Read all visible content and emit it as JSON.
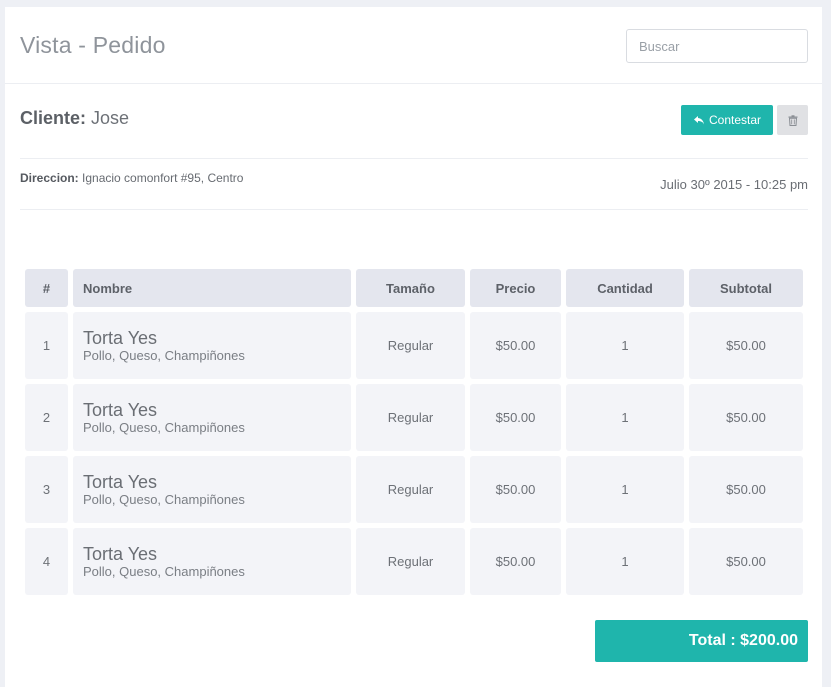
{
  "header": {
    "title": "Vista - Pedido",
    "search_placeholder": "Buscar"
  },
  "client": {
    "label": "Cliente:",
    "name": "Jose"
  },
  "actions": {
    "reply_label": "Contestar",
    "reply_icon": "reply-icon",
    "delete_icon": "trash-icon"
  },
  "address": {
    "label": "Direccion:",
    "value": "Ignacio comonfort #95, Centro"
  },
  "date": "Julio 30º 2015 - 10:25 pm",
  "table": {
    "headers": [
      "#",
      "Nombre",
      "Tamaño",
      "Precio",
      "Cantidad",
      "Subtotal"
    ],
    "rows": [
      {
        "num": "1",
        "name": "Torta Yes",
        "desc": "Pollo, Queso, Champiñones",
        "size": "Regular",
        "price": "$50.00",
        "qty": "1",
        "subtotal": "$50.00"
      },
      {
        "num": "2",
        "name": "Torta Yes",
        "desc": "Pollo, Queso, Champiñones",
        "size": "Regular",
        "price": "$50.00",
        "qty": "1",
        "subtotal": "$50.00"
      },
      {
        "num": "3",
        "name": "Torta Yes",
        "desc": "Pollo, Queso, Champiñones",
        "size": "Regular",
        "price": "$50.00",
        "qty": "1",
        "subtotal": "$50.00"
      },
      {
        "num": "4",
        "name": "Torta Yes",
        "desc": "Pollo, Queso, Champiñones",
        "size": "Regular",
        "price": "$50.00",
        "qty": "1",
        "subtotal": "$50.00"
      }
    ]
  },
  "total": "Total : $200.00",
  "colors": {
    "accent": "#1fb5ac",
    "header_cell": "#e4e6ee",
    "body_cell": "#f3f4f8"
  }
}
